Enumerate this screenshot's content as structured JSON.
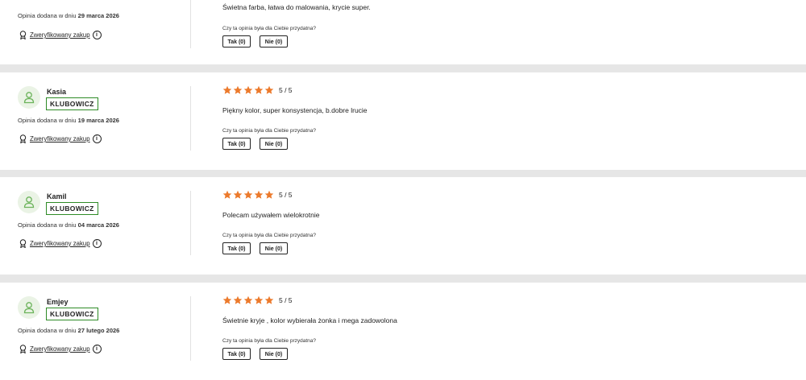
{
  "labels": {
    "badge": "KLUBOWICZ",
    "added_prefix": "Opinia dodana w dniu",
    "verified": "Zweryfikowany zakup",
    "info_glyph": "i",
    "helpful_question": "Czy ta opinia była dla Ciebie przydatna?",
    "yes_button": "Tak (0)",
    "no_button": "Nie (0)",
    "score": "5 / 5"
  },
  "colors": {
    "star": "#ec7a2c",
    "badge_border": "#2e8b26",
    "avatar_bg": "#eaf3e5",
    "avatar_icon": "#6bb35a"
  },
  "reviews": [
    {
      "date": "29 marca 2026",
      "text": "Świetna farba, łatwa do malowania, krycie super."
    },
    {
      "name": "Kasia",
      "date": "19 marca 2026",
      "rating": 5,
      "text": "Piękny kolor, super konsystencja, b.dobre lrucie"
    },
    {
      "name": "Kamil",
      "date": "04 marca 2026",
      "rating": 5,
      "text": "Polecam używałem wielokrotnie"
    },
    {
      "name": "Emjey",
      "date": "27 lutego 2026",
      "rating": 5,
      "text": "Świetnie kryje , kolor wybierała żonka i mega zadowolona"
    }
  ]
}
